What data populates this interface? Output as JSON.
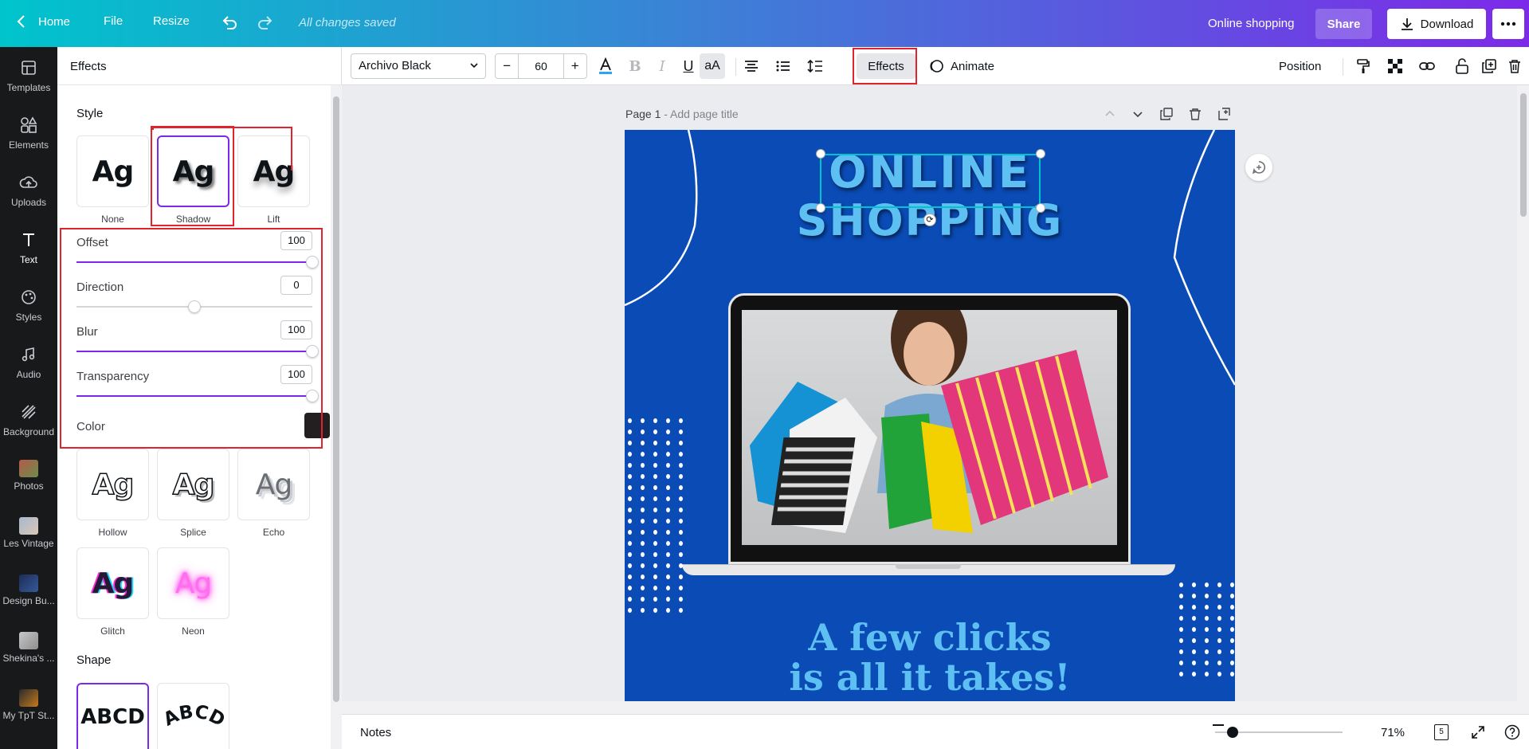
{
  "topbar": {
    "home": "Home",
    "file": "File",
    "resize": "Resize",
    "saved_status": "All changes saved",
    "doc_title": "Online shopping",
    "share": "Share",
    "download": "Download"
  },
  "rail": {
    "items": [
      {
        "label": "Templates",
        "icon": "templates-icon"
      },
      {
        "label": "Elements",
        "icon": "elements-icon"
      },
      {
        "label": "Uploads",
        "icon": "uploads-icon"
      },
      {
        "label": "Text",
        "icon": "text-icon"
      },
      {
        "label": "Styles",
        "icon": "styles-icon"
      },
      {
        "label": "Audio",
        "icon": "audio-icon"
      },
      {
        "label": "Background",
        "icon": "background-icon"
      },
      {
        "label": "Photos",
        "icon": "photos-icon"
      },
      {
        "label": "Les Vintage",
        "icon": "folder-thumbnail"
      },
      {
        "label": "Design Bu...",
        "icon": "folder-thumbnail"
      },
      {
        "label": "Shekina's ...",
        "icon": "folder-thumbnail"
      },
      {
        "label": "My TpT St...",
        "icon": "folder-thumbnail"
      }
    ],
    "active": "Text"
  },
  "panel": {
    "title": "Effects",
    "style_section": "Style",
    "styles": [
      {
        "label": "None"
      },
      {
        "label": "Shadow"
      },
      {
        "label": "Lift"
      },
      {
        "label": "Hollow"
      },
      {
        "label": "Splice"
      },
      {
        "label": "Echo"
      },
      {
        "label": "Glitch"
      },
      {
        "label": "Neon"
      }
    ],
    "card_text": "Ag",
    "selected_style": "Shadow",
    "controls": {
      "offset": {
        "label": "Offset",
        "value": "100",
        "fraction": 1.0
      },
      "direction": {
        "label": "Direction",
        "value": "0",
        "fraction": 0.5
      },
      "blur": {
        "label": "Blur",
        "value": "100",
        "fraction": 1.0
      },
      "transparency": {
        "label": "Transparency",
        "value": "100",
        "fraction": 1.0
      },
      "color": {
        "label": "Color",
        "value": "#231f20"
      }
    },
    "shape_section": "Shape",
    "shape_text": "ABCD"
  },
  "toolbar": {
    "font": "Archivo Black",
    "size": "60",
    "minus": "−",
    "plus": "+",
    "effects": "Effects",
    "animate": "Animate",
    "position": "Position"
  },
  "canvas": {
    "page_label": "Page 1",
    "page_sub": " - Add page title",
    "heading_line1": "ONLINE",
    "heading_line2": "SHOPPING",
    "tagline_line1": "A few clicks",
    "tagline_line2": "is all it takes!"
  },
  "bottombar": {
    "notes": "Notes",
    "zoom": "71%",
    "pages": "5"
  },
  "colors": {
    "accent": "#7d2ae8",
    "highlight": "#e0242e",
    "design_bg": "#0a4bb5",
    "heading": "#5ec0f2"
  }
}
